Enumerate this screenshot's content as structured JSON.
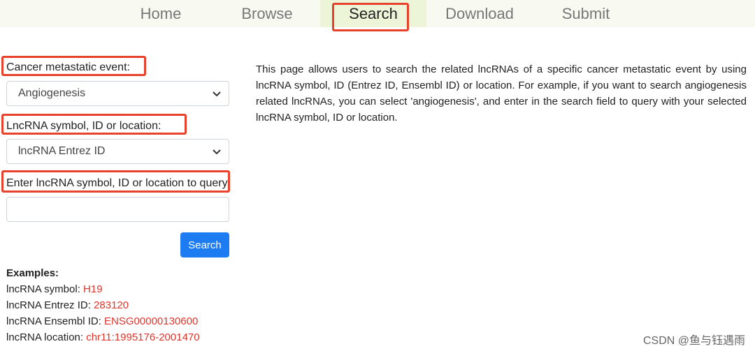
{
  "nav": {
    "items": [
      {
        "label": "Home"
      },
      {
        "label": "Browse"
      },
      {
        "label": "Search"
      },
      {
        "label": "Download"
      },
      {
        "label": "Submit"
      }
    ],
    "active": "Search"
  },
  "form": {
    "event_label": "Cancer metastatic event:",
    "event_selected": "Angiogenesis",
    "type_label": "LncRNA symbol, ID or location:",
    "type_selected": "lncRNA Entrez ID",
    "query_label": "Enter lncRNA symbol, ID or location to query:",
    "query_value": "",
    "search_button": "Search"
  },
  "examples": {
    "title": "Examples:",
    "rows": [
      {
        "label": "lncRNA symbol: ",
        "value": "H19"
      },
      {
        "label": "lncRNA Entrez ID: ",
        "value": "283120"
      },
      {
        "label": "lncRNA Ensembl ID: ",
        "value": "ENSG00000130600"
      },
      {
        "label": "lncRNA location: ",
        "value": "chr11:1995176-2001470"
      }
    ]
  },
  "description": "This page allows users to search the related lncRNAs of a specific cancer metastatic event by using lncRNA symbol, ID (Entrez ID, Ensembl ID) or location. For example, if you want to search angiogenesis related lncRNAs, you can select 'angiogenesis', and enter in the search field to query with your selected lncRNA symbol, ID or location.",
  "watermark": "CSDN @鱼与钰遇雨",
  "colors": {
    "highlight_box": "#e8412c",
    "link": "#e0342a",
    "button": "#1e7cf2",
    "nav_active_bg": "#edf5d8"
  }
}
